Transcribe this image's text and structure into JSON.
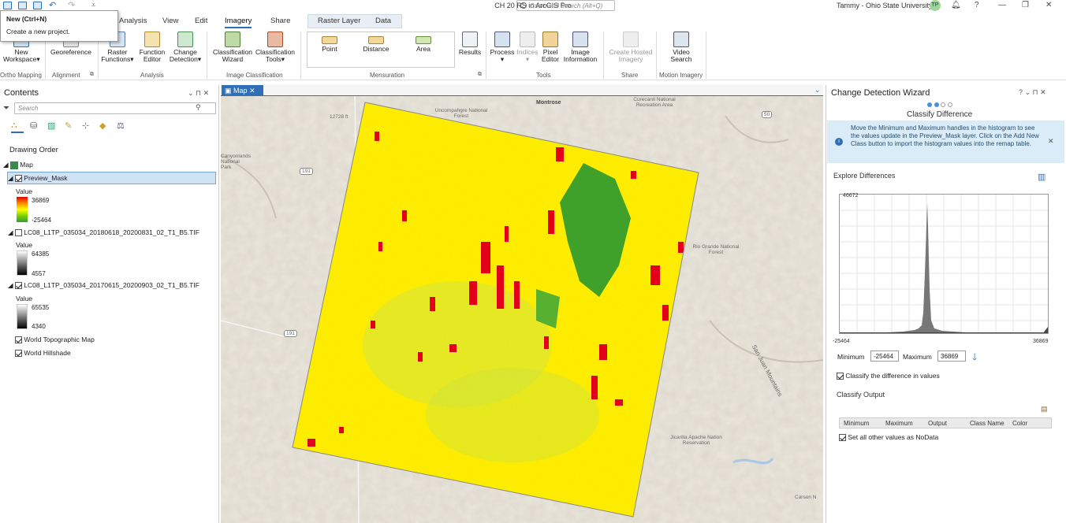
{
  "app": {
    "title": "CH 20 RS in ArcGIS Pro",
    "command_search": "Command Search (Alt+Q)",
    "user": "Tammy - Ohio State University",
    "avatar": "TP"
  },
  "tooltip": {
    "title": "New (Ctrl+N)",
    "text": "Create a new project."
  },
  "tabs": [
    "Analysis",
    "View",
    "Edit",
    "Imagery",
    "Share"
  ],
  "context_tabs": {
    "group": "Raster Layer",
    "data": "Data"
  },
  "ribbon": {
    "buttons": [
      {
        "label": "New Workspace",
        "l1": "New",
        "l2": "Workspace"
      },
      {
        "label": "Georeference",
        "l1": "Georeference",
        "l2": ""
      },
      {
        "l1": "Raster",
        "l2": "Functions"
      },
      {
        "l1": "Function",
        "l2": "Editor"
      },
      {
        "l1": "Change",
        "l2": "Detection"
      },
      {
        "l1": "Classification",
        "l2": "Wizard"
      },
      {
        "l1": "Classification",
        "l2": "Tools"
      },
      {
        "l1": "Results",
        "l2": ""
      },
      {
        "l1": "Process",
        "l2": ""
      },
      {
        "l1": "Indices",
        "l2": ""
      },
      {
        "l1": "Pixel",
        "l2": "Editor"
      },
      {
        "l1": "Image",
        "l2": "Information"
      },
      {
        "l1": "Create Hosted",
        "l2": "Imagery"
      },
      {
        "l1": "Video",
        "l2": "Search"
      }
    ],
    "mensuration": [
      "Point",
      "Distance",
      "Area"
    ],
    "groups": [
      "Ortho Mapping",
      "Alignment",
      "Analysis",
      "Image Classification",
      "Mensuration",
      "Tools",
      "Share",
      "Motion Imagery"
    ]
  },
  "contents": {
    "title": "Contents",
    "search_placeholder": "Search",
    "drawing_order": "Drawing Order",
    "map": "Map",
    "layers": [
      {
        "name": "Preview_Mask",
        "checked": true,
        "legend_title": "Value",
        "max": "36869",
        "min": "-25464",
        "ramp": "rg"
      },
      {
        "name": "LC08_L1TP_035034_20180618_20200831_02_T1_B5.TIF",
        "checked": false,
        "legend_title": "Value",
        "max": "64385",
        "min": "4557",
        "ramp": "gray"
      },
      {
        "name": "LC08_L1TP_035034_20170615_20200903_02_T1_B5.TIF",
        "checked": true,
        "legend_title": "Value",
        "max": "65535",
        "min": "4340",
        "ramp": "gray"
      },
      {
        "name": "World Topographic Map",
        "checked": true
      },
      {
        "name": "World Hillshade",
        "checked": true
      }
    ]
  },
  "map": {
    "tab": "Map",
    "labels": [
      "Montrose",
      "Uncompahgre National Forest",
      "Curecanti National Recreation Area",
      "12728 ft",
      "Rio Grande National Forest",
      "San Juan Mountains",
      "Jicarilla Apache Nation Reservation",
      "Carson N",
      "Canyonlands National Park",
      "191",
      "50",
      "191"
    ]
  },
  "wizard": {
    "title": "Change Detection Wizard",
    "step": "Classify Difference",
    "info": "Move the Minimum and Maximum handles in the histogram to see the values update in the Preview_Mask layer. Click on the Add New Class button to import the histogram values into the remap table.",
    "explore": "Explore Differences",
    "hist_ymax": "46672",
    "hist_xmin": "-25464",
    "hist_xmax": "36869",
    "min_label": "Minimum",
    "min_value": "-25464",
    "max_label": "Maximum",
    "max_value": "36869",
    "classify_checkbox": "Classify the difference in values",
    "output_title": "Classify Output",
    "table_headers": [
      "Minimum",
      "Maximum",
      "Output",
      "Class Name",
      "Color"
    ],
    "nodata": "Set all other values as NoData"
  }
}
